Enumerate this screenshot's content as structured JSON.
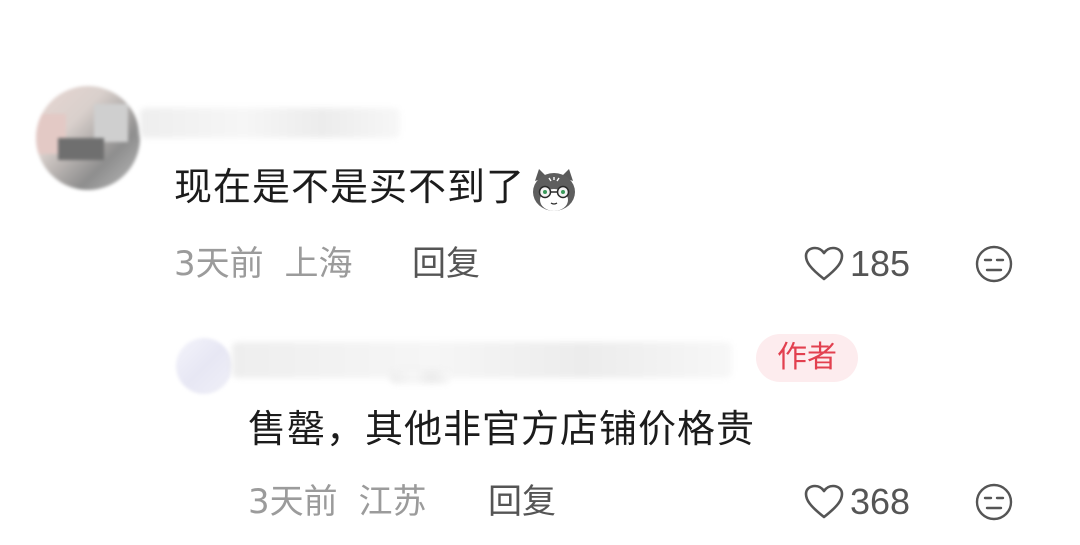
{
  "comments": [
    {
      "text": "现在是不是买不到了",
      "emoji": "cat-emoji",
      "time": "3天前",
      "location": "上海",
      "reply_label": "回复",
      "likes": "185",
      "is_author": false
    },
    {
      "text": "售罄，其他非官方店铺价格贵",
      "time": "3天前",
      "location": "江苏",
      "reply_label": "回复",
      "likes": "368",
      "is_author": true,
      "badge": "作者"
    }
  ],
  "icons": {
    "like": "heart-outline-icon",
    "dislike": "meh-face-icon"
  },
  "colors": {
    "badge_bg": "#fdecee",
    "badge_text": "#e2404f",
    "meta_text": "#9b9b9b"
  }
}
